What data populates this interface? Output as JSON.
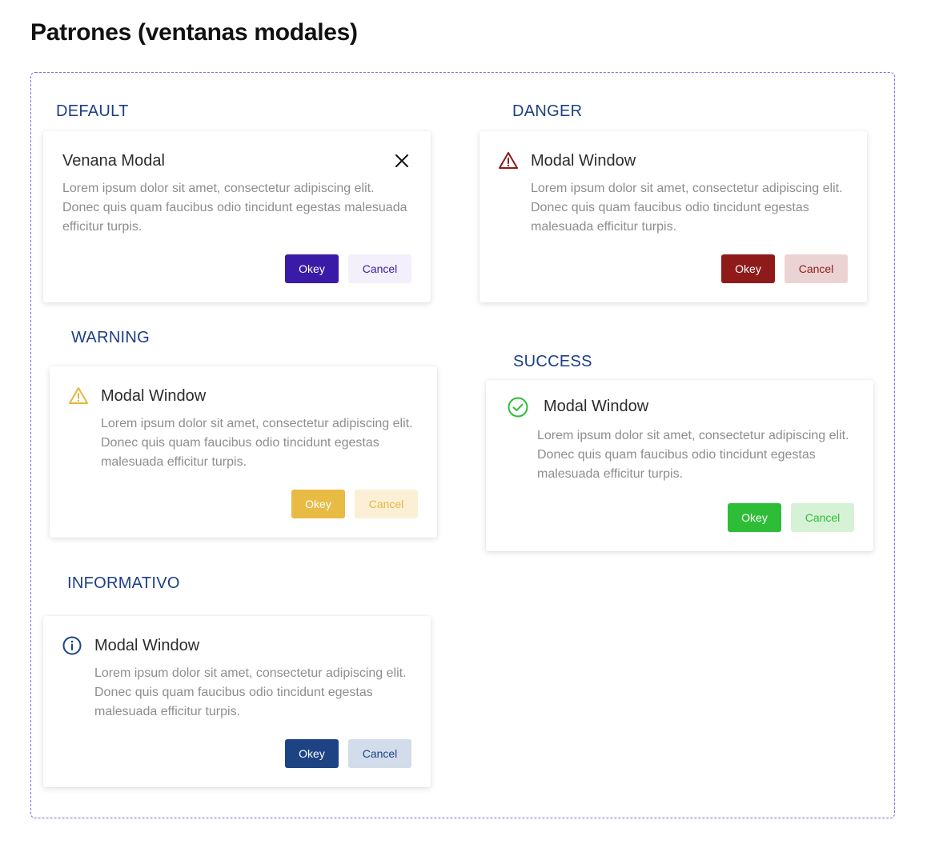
{
  "page": {
    "title": "Patrones (ventanas modales)"
  },
  "sections": {
    "default": {
      "label": "DEFAULT",
      "title": "Venana Modal",
      "body": "Lorem ipsum dolor sit amet, consectetur adipiscing elit. Donec quis quam faucibus odio tincidunt egestas malesuada efficitur turpis.",
      "okey": "Okey",
      "cancel": "Cancel",
      "icon": "close-icon",
      "colors": {
        "primary": "#3a1ba8",
        "cancel_bg": "#f3f0fc",
        "cancel_text": "#3a1ba8"
      }
    },
    "danger": {
      "label": "DANGER",
      "title": "Modal Window",
      "body": "Lorem ipsum dolor sit amet, consectetur adipiscing elit. Donec quis quam faucibus odio tincidunt egestas malesuada efficitur turpis.",
      "okey": "Okey",
      "cancel": "Cancel",
      "icon": "warning-triangle-icon",
      "colors": {
        "primary": "#8f1a1a",
        "cancel_bg": "#ecd3d3",
        "cancel_text": "#8f1a1a"
      }
    },
    "warning": {
      "label": "WARNING",
      "title": "Modal Window",
      "body": "Lorem ipsum dolor sit amet, consectetur adipiscing elit. Donec quis quam faucibus odio tincidunt egestas malesuada efficitur turpis.",
      "okey": "Okey",
      "cancel": "Cancel",
      "icon": "warning-triangle-icon",
      "colors": {
        "primary": "#e8bb45",
        "cancel_bg": "#fbf0d6",
        "cancel_text": "#e3b83f"
      }
    },
    "success": {
      "label": "SUCCESS",
      "title": "Modal Window",
      "body": "Lorem ipsum dolor sit amet, consectetur adipiscing elit. Donec quis quam faucibus odio tincidunt egestas malesuada efficitur turpis.",
      "okey": "Okey",
      "cancel": "Cancel",
      "icon": "check-circle-icon",
      "colors": {
        "primary": "#2ebd37",
        "cancel_bg": "#d6f2d6",
        "cancel_text": "#2ebd37"
      }
    },
    "info": {
      "label": "INFORMATIVO",
      "title": "Modal Window",
      "body": "Lorem ipsum dolor sit amet, consectetur adipiscing elit. Donec quis quam faucibus odio tincidunt egestas malesuada efficitur turpis.",
      "okey": "Okey",
      "cancel": "Cancel",
      "icon": "info-circle-icon",
      "colors": {
        "primary": "#1d4385",
        "cancel_bg": "#d2dcea",
        "cancel_text": "#1d4385"
      }
    }
  }
}
